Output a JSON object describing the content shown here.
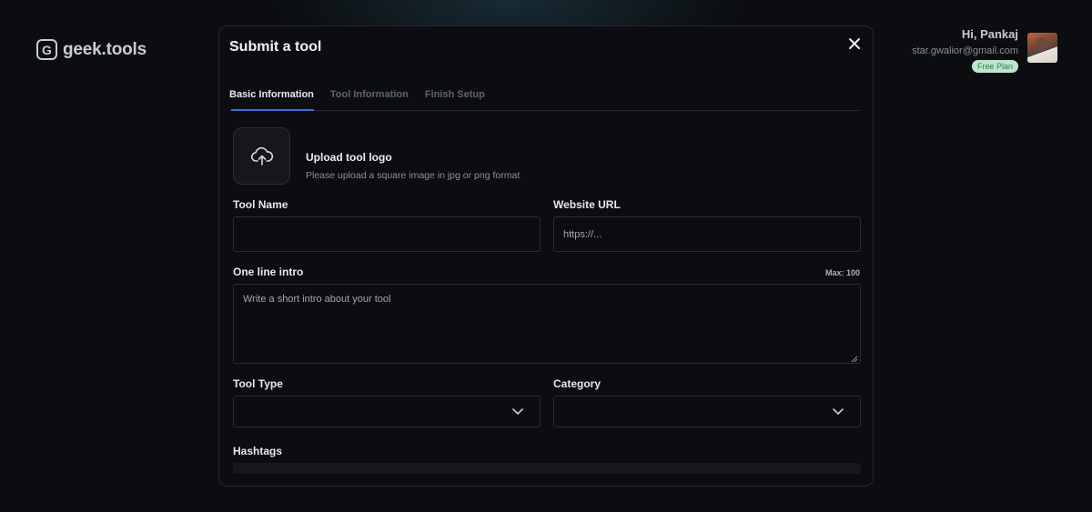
{
  "brand": {
    "name": "geek.tools",
    "mark": "G"
  },
  "user": {
    "greeting": "Hi, Pankaj",
    "email": "star.gwalior@gmail.com",
    "plan": "Free Plan"
  },
  "modal": {
    "title": "Submit a tool",
    "tabs": [
      {
        "label": "Basic Information",
        "active": true
      },
      {
        "label": "Tool Information",
        "active": false
      },
      {
        "label": "Finish Setup",
        "active": false
      }
    ],
    "upload": {
      "title": "Upload tool logo",
      "subtitle": "Please upload a square image in jpg or png format"
    },
    "fields": {
      "tool_name": {
        "label": "Tool Name",
        "value": "",
        "placeholder": ""
      },
      "website_url": {
        "label": "Website URL",
        "value": "",
        "placeholder": "https://..."
      },
      "intro": {
        "label": "One line intro",
        "max_note": "Max: 100",
        "value": "",
        "placeholder": "Write a short intro about your tool"
      },
      "tool_type": {
        "label": "Tool Type",
        "value": ""
      },
      "category": {
        "label": "Category",
        "value": ""
      },
      "hashtags": {
        "label": "Hashtags"
      }
    }
  },
  "colors": {
    "background": "#0b0d10",
    "accent": "#3b6fd8",
    "plan_badge": "#bfe6cd"
  },
  "icons": {
    "close": "close-icon",
    "upload": "upload-cloud-icon",
    "chevron": "chevron-down-icon"
  }
}
